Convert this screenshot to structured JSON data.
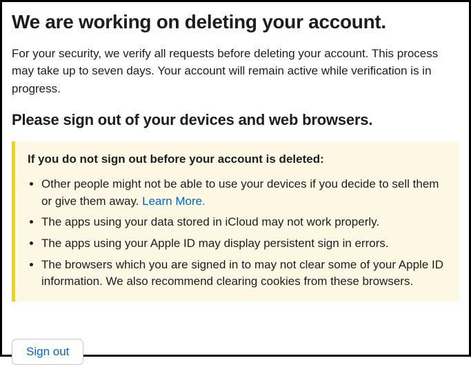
{
  "title": "We are working on deleting your account.",
  "description": "For your security, we verify all requests before deleting your account. This process may take up to seven days. Your account will remain active while verification is in progress.",
  "subtitle": "Please sign out of your devices and web browsers.",
  "warning": {
    "heading": "If you do not sign out before your account is deleted:",
    "items": [
      {
        "text_before": "Other people might not be able to use your devices if you decide to sell them or give them away. ",
        "link_text": "Learn More.",
        "text_after": ""
      },
      {
        "text_before": "The apps using your data stored in iCloud may not work properly.",
        "link_text": "",
        "text_after": ""
      },
      {
        "text_before": "The apps using your Apple ID may display persistent sign in errors.",
        "link_text": "",
        "text_after": ""
      },
      {
        "text_before": "The browsers which you are signed in to may not clear some of your Apple ID information. We also recommend clearing cookies from these browsers.",
        "link_text": "",
        "text_after": ""
      }
    ]
  },
  "signout_button": "Sign out"
}
